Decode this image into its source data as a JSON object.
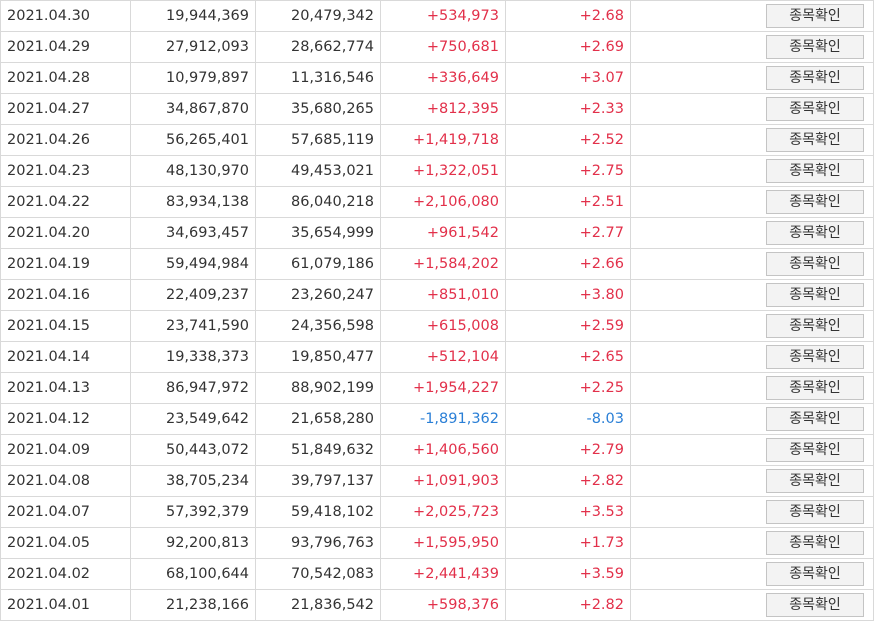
{
  "colors": {
    "up": "#e2304a",
    "down": "#2a7fd6"
  },
  "button_label": "종목확인",
  "rows": [
    {
      "date": "2021.04.30",
      "v1": "19,944,369",
      "v2": "20,479,342",
      "change": "+534,973",
      "rate": "+2.68",
      "dir": "up"
    },
    {
      "date": "2021.04.29",
      "v1": "27,912,093",
      "v2": "28,662,774",
      "change": "+750,681",
      "rate": "+2.69",
      "dir": "up"
    },
    {
      "date": "2021.04.28",
      "v1": "10,979,897",
      "v2": "11,316,546",
      "change": "+336,649",
      "rate": "+3.07",
      "dir": "up"
    },
    {
      "date": "2021.04.27",
      "v1": "34,867,870",
      "v2": "35,680,265",
      "change": "+812,395",
      "rate": "+2.33",
      "dir": "up"
    },
    {
      "date": "2021.04.26",
      "v1": "56,265,401",
      "v2": "57,685,119",
      "change": "+1,419,718",
      "rate": "+2.52",
      "dir": "up"
    },
    {
      "date": "2021.04.23",
      "v1": "48,130,970",
      "v2": "49,453,021",
      "change": "+1,322,051",
      "rate": "+2.75",
      "dir": "up"
    },
    {
      "date": "2021.04.22",
      "v1": "83,934,138",
      "v2": "86,040,218",
      "change": "+2,106,080",
      "rate": "+2.51",
      "dir": "up"
    },
    {
      "date": "2021.04.20",
      "v1": "34,693,457",
      "v2": "35,654,999",
      "change": "+961,542",
      "rate": "+2.77",
      "dir": "up"
    },
    {
      "date": "2021.04.19",
      "v1": "59,494,984",
      "v2": "61,079,186",
      "change": "+1,584,202",
      "rate": "+2.66",
      "dir": "up"
    },
    {
      "date": "2021.04.16",
      "v1": "22,409,237",
      "v2": "23,260,247",
      "change": "+851,010",
      "rate": "+3.80",
      "dir": "up"
    },
    {
      "date": "2021.04.15",
      "v1": "23,741,590",
      "v2": "24,356,598",
      "change": "+615,008",
      "rate": "+2.59",
      "dir": "up"
    },
    {
      "date": "2021.04.14",
      "v1": "19,338,373",
      "v2": "19,850,477",
      "change": "+512,104",
      "rate": "+2.65",
      "dir": "up"
    },
    {
      "date": "2021.04.13",
      "v1": "86,947,972",
      "v2": "88,902,199",
      "change": "+1,954,227",
      "rate": "+2.25",
      "dir": "up"
    },
    {
      "date": "2021.04.12",
      "v1": "23,549,642",
      "v2": "21,658,280",
      "change": "-1,891,362",
      "rate": "-8.03",
      "dir": "down"
    },
    {
      "date": "2021.04.09",
      "v1": "50,443,072",
      "v2": "51,849,632",
      "change": "+1,406,560",
      "rate": "+2.79",
      "dir": "up"
    },
    {
      "date": "2021.04.08",
      "v1": "38,705,234",
      "v2": "39,797,137",
      "change": "+1,091,903",
      "rate": "+2.82",
      "dir": "up"
    },
    {
      "date": "2021.04.07",
      "v1": "57,392,379",
      "v2": "59,418,102",
      "change": "+2,025,723",
      "rate": "+3.53",
      "dir": "up"
    },
    {
      "date": "2021.04.05",
      "v1": "92,200,813",
      "v2": "93,796,763",
      "change": "+1,595,950",
      "rate": "+1.73",
      "dir": "up"
    },
    {
      "date": "2021.04.02",
      "v1": "68,100,644",
      "v2": "70,542,083",
      "change": "+2,441,439",
      "rate": "+3.59",
      "dir": "up"
    },
    {
      "date": "2021.04.01",
      "v1": "21,238,166",
      "v2": "21,836,542",
      "change": "+598,376",
      "rate": "+2.82",
      "dir": "up"
    }
  ]
}
